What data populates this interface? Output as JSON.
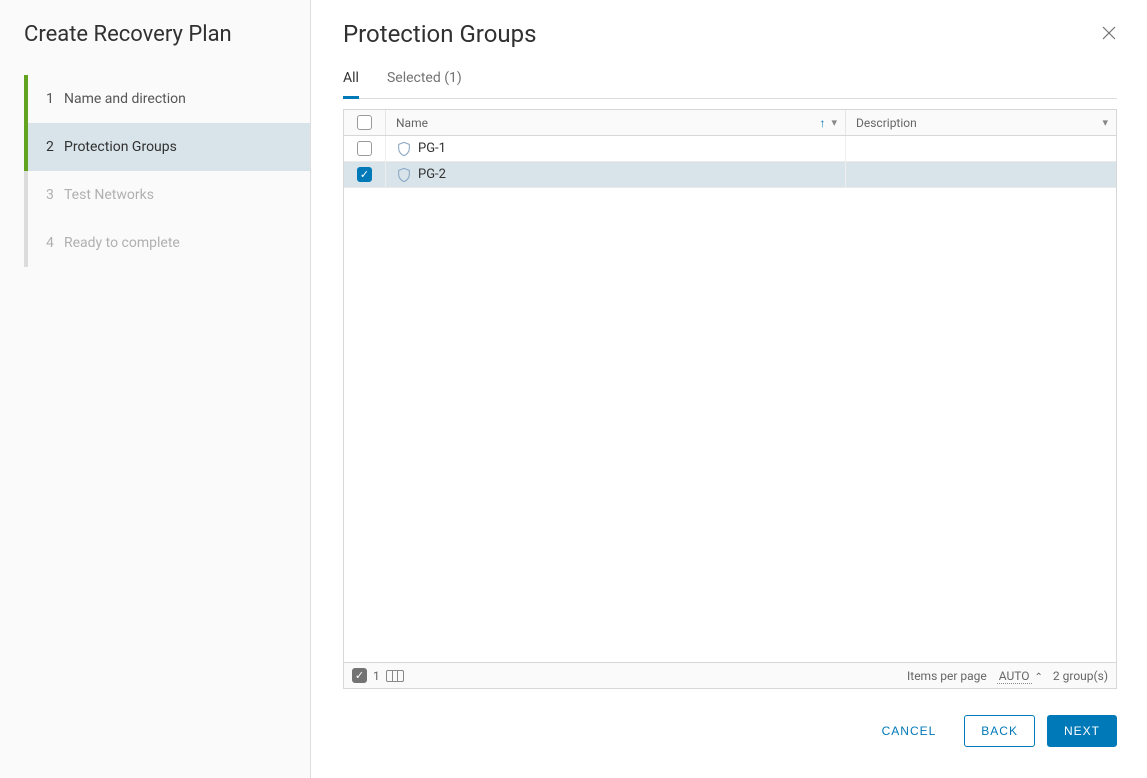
{
  "sidebar": {
    "title": "Create Recovery Plan",
    "steps": [
      {
        "num": "1",
        "label": "Name and direction"
      },
      {
        "num": "2",
        "label": "Protection Groups"
      },
      {
        "num": "3",
        "label": "Test Networks"
      },
      {
        "num": "4",
        "label": "Ready to complete"
      }
    ]
  },
  "main": {
    "title": "Protection Groups",
    "tabs": {
      "all": "All",
      "selected": "Selected (1)"
    },
    "table": {
      "header": {
        "name": "Name",
        "description": "Description"
      },
      "rows": [
        {
          "name": "PG-1",
          "desc": "",
          "checked": false
        },
        {
          "name": "PG-2",
          "desc": "",
          "checked": true
        }
      ],
      "footer": {
        "selected_count": "1",
        "items_per_page_label": "Items per page",
        "items_per_page_value": "AUTO",
        "total": "2 group(s)"
      }
    }
  },
  "buttons": {
    "cancel": "CANCEL",
    "back": "BACK",
    "next": "NEXT"
  }
}
